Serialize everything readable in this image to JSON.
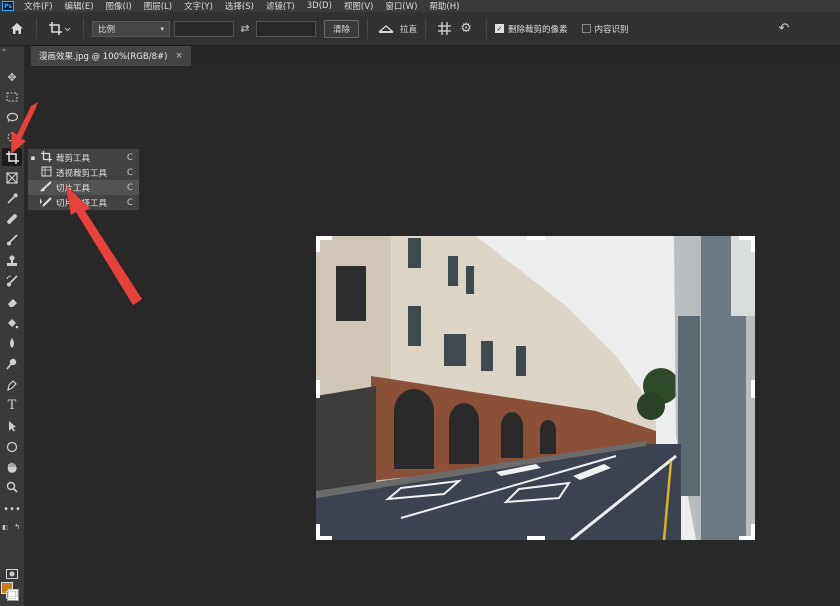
{
  "menubar": {
    "logo": "Ps",
    "items": [
      "文件(F)",
      "编辑(E)",
      "图像(I)",
      "图层(L)",
      "文字(Y)",
      "选择(S)",
      "滤镜(T)",
      "3D(D)",
      "视图(V)",
      "窗口(W)",
      "帮助(H)"
    ]
  },
  "options": {
    "ratio_label": "比例",
    "clear_label": "清除",
    "straighten_label": "拉直",
    "delete_cropped_label": "删除裁剪的像素",
    "delete_cropped_checked": true,
    "content_aware_label": "内容识别",
    "content_aware_checked": false
  },
  "document": {
    "tab_title": "漫画效果.jpg @ 100%(RGB/8#)",
    "close": "×"
  },
  "toolbox": {
    "grip": "»",
    "tools": [
      "move-icon",
      "marquee-icon",
      "lasso-icon",
      "quick-select-icon",
      "crop-icon",
      "frame-icon",
      "eyedropper-icon",
      "healing-icon",
      "brush-icon",
      "stamp-icon",
      "history-brush-icon",
      "eraser-icon",
      "paint-bucket-icon",
      "blur-icon",
      "dodge-icon",
      "pen-icon",
      "type-icon",
      "path-select-icon",
      "shape-icon",
      "hand-icon",
      "zoom-icon",
      "more-icon"
    ],
    "foreground_color": "#c67f1c",
    "background_color": "#ffffff"
  },
  "flyout": {
    "items": [
      {
        "label": "裁剪工具",
        "key": "C",
        "bullet": "▪",
        "icon": "crop-icon"
      },
      {
        "label": "透视裁剪工具",
        "key": "C",
        "bullet": "",
        "icon": "perspective-crop-icon"
      },
      {
        "label": "切片工具",
        "key": "C",
        "bullet": "",
        "icon": "slice-icon"
      },
      {
        "label": "切片选择工具",
        "key": "C",
        "bullet": "",
        "icon": "slice-select-icon"
      }
    ]
  },
  "colors": {
    "annotation_arrow": "#e8413a"
  }
}
